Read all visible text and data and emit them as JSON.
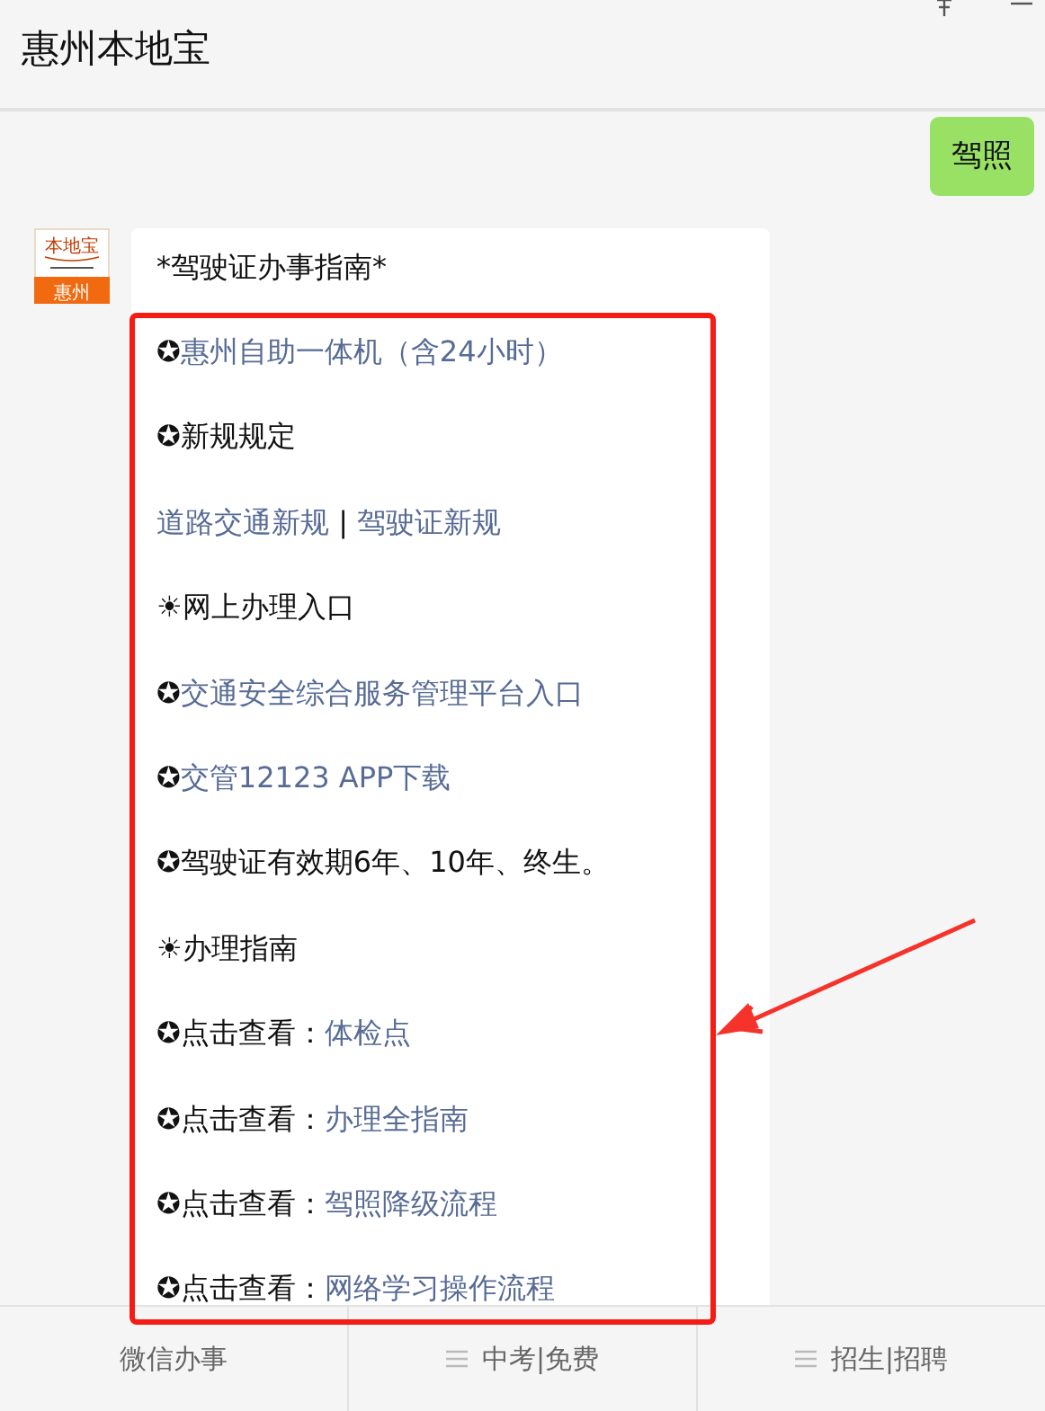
{
  "window": {
    "title": "惠州本地宝"
  },
  "messages": [
    {
      "kind": "sent",
      "text": "驾照"
    },
    {
      "kind": "received",
      "avatar": {
        "top": "本地宝",
        "bottom": "惠州"
      },
      "title": "*驾驶证办事指南*",
      "lines": [
        [
          {
            "text": "✪",
            "link": false
          },
          {
            "text": "惠州自助一体机（含24小时）",
            "link": true
          }
        ],
        [
          {
            "text": "✪新规规定",
            "link": false
          }
        ],
        [
          {
            "text": "道路交通新规",
            "link": true
          },
          {
            "text": " | ",
            "link": false
          },
          {
            "text": "驾驶证新规",
            "link": true
          }
        ],
        [
          {
            "text": "☀网上办理入口",
            "link": false
          }
        ],
        [
          {
            "text": "✪",
            "link": false
          },
          {
            "text": "交通安全综合服务管理平台入口",
            "link": true
          }
        ],
        [
          {
            "text": "✪",
            "link": false
          },
          {
            "text": "交管12123 APP下载",
            "link": true
          }
        ],
        [
          {
            "text": "✪驾驶证有效期6年、10年、终生。",
            "link": false
          }
        ],
        [
          {
            "text": "☀办理指南",
            "link": false
          }
        ],
        [
          {
            "text": "✪点击查看：",
            "link": false
          },
          {
            "text": "体检点",
            "link": true
          }
        ],
        [
          {
            "text": "✪点击查看：",
            "link": false
          },
          {
            "text": "办理全指南",
            "link": true
          }
        ],
        [
          {
            "text": "✪点击查看：",
            "link": false
          },
          {
            "text": "驾照降级流程",
            "link": true
          }
        ],
        [
          {
            "text": "✪点击查看：",
            "link": false
          },
          {
            "text": "网络学习操作流程",
            "link": true
          }
        ]
      ]
    }
  ],
  "menu": [
    {
      "label": "微信办事",
      "submenu": false
    },
    {
      "label": "中考|免费",
      "submenu": true
    },
    {
      "label": "招生|招聘",
      "submenu": true
    }
  ]
}
